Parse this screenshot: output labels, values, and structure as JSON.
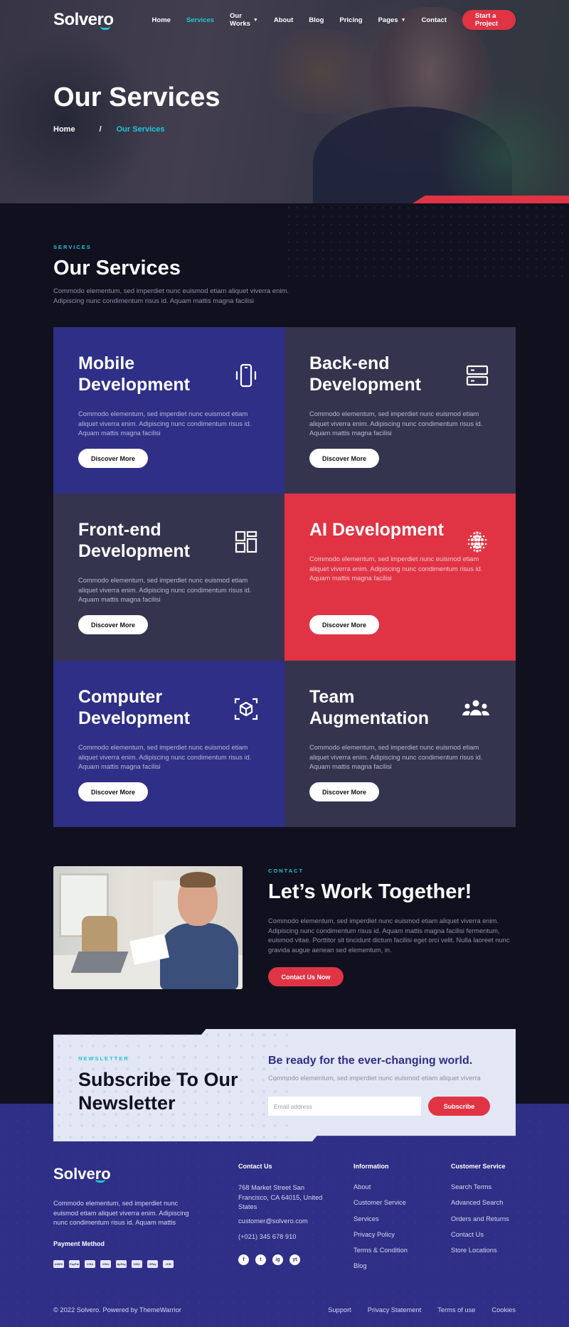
{
  "nav": {
    "logo": "Solvero",
    "items": [
      {
        "label": "Home"
      },
      {
        "label": "Services",
        "active": true
      },
      {
        "label": "Our Works",
        "dropdown": true
      },
      {
        "label": "About"
      },
      {
        "label": "Blog"
      },
      {
        "label": "Pricing"
      },
      {
        "label": "Pages",
        "dropdown": true
      },
      {
        "label": "Contact"
      }
    ],
    "cta": "Start a Project"
  },
  "hero": {
    "title": "Our Services",
    "breadcrumb_home": "Home",
    "breadcrumb_sep": "/",
    "breadcrumb_current": "Our Services"
  },
  "services": {
    "eyebrow": "SERVICES",
    "title": "Our Services",
    "desc_line1": "Commodo elementum, sed imperdiet nunc euismod etiam aliquet viverra enim.",
    "desc_line2": "Adipiscing nunc condimentum risus id. Aquam mattis magna facilisi",
    "cards": [
      {
        "title": "Mobile Development",
        "icon": "mobile-phone-icon",
        "text": "Commodo elementum, sed imperdiet nunc euismod etiam aliquet viverra enim. Adipiscing nunc condimentum risus id. Aquam mattis magna facilisi",
        "button": "Discover More"
      },
      {
        "title": "Back-end Development",
        "icon": "server-icon",
        "text": "Commodo elementum, sed imperdiet nunc euismod etiam aliquet viverra enim. Adipiscing nunc condimentum risus id. Aquam mattis magna facilisi",
        "button": "Discover More"
      },
      {
        "title": "Front-end Development",
        "icon": "dashboard-icon",
        "text": "Commodo elementum, sed imperdiet nunc euismod etiam aliquet viverra enim. Adipiscing nunc condimentum risus id. Aquam mattis magna facilisi",
        "button": "Discover More"
      },
      {
        "title": "AI Development",
        "icon": "ai-dots-icon",
        "text": "Commodo elementum, sed imperdiet nunc euismod etiam aliquet viverra enim. Adipiscing nunc condimentum risus id. Aquam mattis magna facilisi",
        "button": "Discover More"
      },
      {
        "title": "Computer Development",
        "icon": "cube-icon",
        "text": "Commodo elementum, sed imperdiet nunc euismod etiam aliquet viverra enim. Adipiscing nunc condimentum risus id. Aquam mattis magna facilisi",
        "button": "Discover More"
      },
      {
        "title": "Team Augmentation",
        "icon": "team-icon",
        "text": "Commodo elementum, sed imperdiet nunc euismod etiam aliquet viverra enim. Adipiscing nunc condimentum risus id. Aquam mattis magna facilisi",
        "button": "Discover More"
      }
    ]
  },
  "contact": {
    "eyebrow": "CONTACT",
    "title": "Let’s Work Together!",
    "desc": "Commodo elementum, sed imperdiet nunc euismod etiam aliquet viverra enim. Adipiscing nunc condimentum risus id. Aquam mattis magna facilisi fermentum, euismod vitae. Porttitor sit tincidunt dictum facilisi eget orci velit. Nulla laoreet nunc gravida augue aenean sed elementum, in.",
    "button": "Contact Us Now"
  },
  "newsletter": {
    "eyebrow": "NEWSLETTER",
    "title": "Subscribe To Our Newsletter",
    "heading": "Be ready for the ever-changing world.",
    "desc": "Commodo elementum, sed imperdiet nunc euismod etiam aliquet viverra",
    "placeholder": "Email address",
    "value": "",
    "button": "Subscribe"
  },
  "footer": {
    "logo": "Solvero",
    "about": "Commodo elementum, sed imperdiet nunc euismod etiam aliquet viverra enim. Adipiscing nunc condimentum risus id. Aquam mattis",
    "payment_heading": "Payment Method",
    "payments": [
      "AMEX",
      "PayPal",
      "VISA",
      "VISA",
      "ApPay",
      "DISC",
      "GPay",
      "JCB"
    ],
    "contact_heading": "Contact Us",
    "address": "768 Market Street San Francisco, CA 64015, United States",
    "email": "customer@solvero.com",
    "phone": "(+021) 345 678 910",
    "social": [
      "f",
      "t",
      "ig",
      "yt"
    ],
    "info_heading": "Information",
    "info_links": [
      "About",
      "Customer Service",
      "Services",
      "Privacy Policy",
      "Terms & Condition",
      "Blog"
    ],
    "cs_heading": "Customer Service",
    "cs_links": [
      "Search Terms",
      "Advanced Search",
      "Orders and Returns",
      "Contact Us",
      "Store Locations"
    ],
    "copyright": "© 2022 Solvero. Powered by ThemeWarrior",
    "bottom_links": [
      "Support",
      "Privacy Statement",
      "Terms of use",
      "Cookies"
    ]
  },
  "colors": {
    "accent": "#e03444",
    "cyan": "#1ec8d8",
    "blue": "#2f2f87",
    "slate": "#35344f",
    "dark": "#10101f"
  }
}
